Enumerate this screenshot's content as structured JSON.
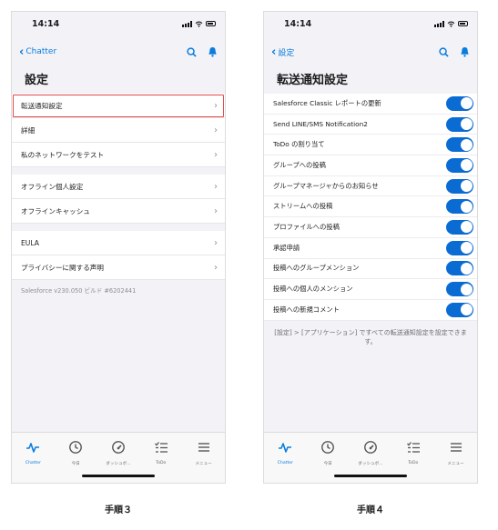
{
  "statusbar": {
    "time": "14:14"
  },
  "screen1": {
    "back_label": "Chatter",
    "title": "設定",
    "groups": [
      [
        {
          "label": "転送通知設定",
          "highlighted": true
        },
        {
          "label": "詳細"
        },
        {
          "label": "私のネットワークをテスト"
        }
      ],
      [
        {
          "label": "オフライン個人設定"
        },
        {
          "label": "オフラインキャッシュ"
        }
      ],
      [
        {
          "label": "EULA"
        },
        {
          "label": "プライバシーに関する声明"
        }
      ]
    ],
    "version": "Salesforce v230.050 ビルド #6202441"
  },
  "screen2": {
    "back_label": "設定",
    "title": "転送通知設定",
    "items": [
      "Salesforce Classic レポートの更新",
      "Send LINE/SMS Notification2",
      "ToDo の割り当て",
      "グループへの投稿",
      "グループマネージャからのお知らせ",
      "ストリームへの投稿",
      "プロファイルへの投稿",
      "承認申請",
      "投稿へのグループメンション",
      "投稿への個人のメンション",
      "投稿への新規コメント"
    ],
    "note": "[設定] > [アプリケーション] ですべての転送通知設定を設定できます。"
  },
  "tabbar": {
    "tabs": [
      {
        "label": "Chatter",
        "icon": "pulse-icon"
      },
      {
        "label": "今日",
        "icon": "clock-icon"
      },
      {
        "label": "ダッシュボ...",
        "icon": "gauge-icon"
      },
      {
        "label": "ToDo",
        "icon": "checklist-icon"
      },
      {
        "label": "メニュー",
        "icon": "menu-icon"
      }
    ]
  },
  "captions": {
    "step3": "手順３",
    "step4": "手順４"
  },
  "colors": {
    "accent": "#0a7cde",
    "toggle_on": "#0a6bd3",
    "highlight": "#e24b4b"
  }
}
